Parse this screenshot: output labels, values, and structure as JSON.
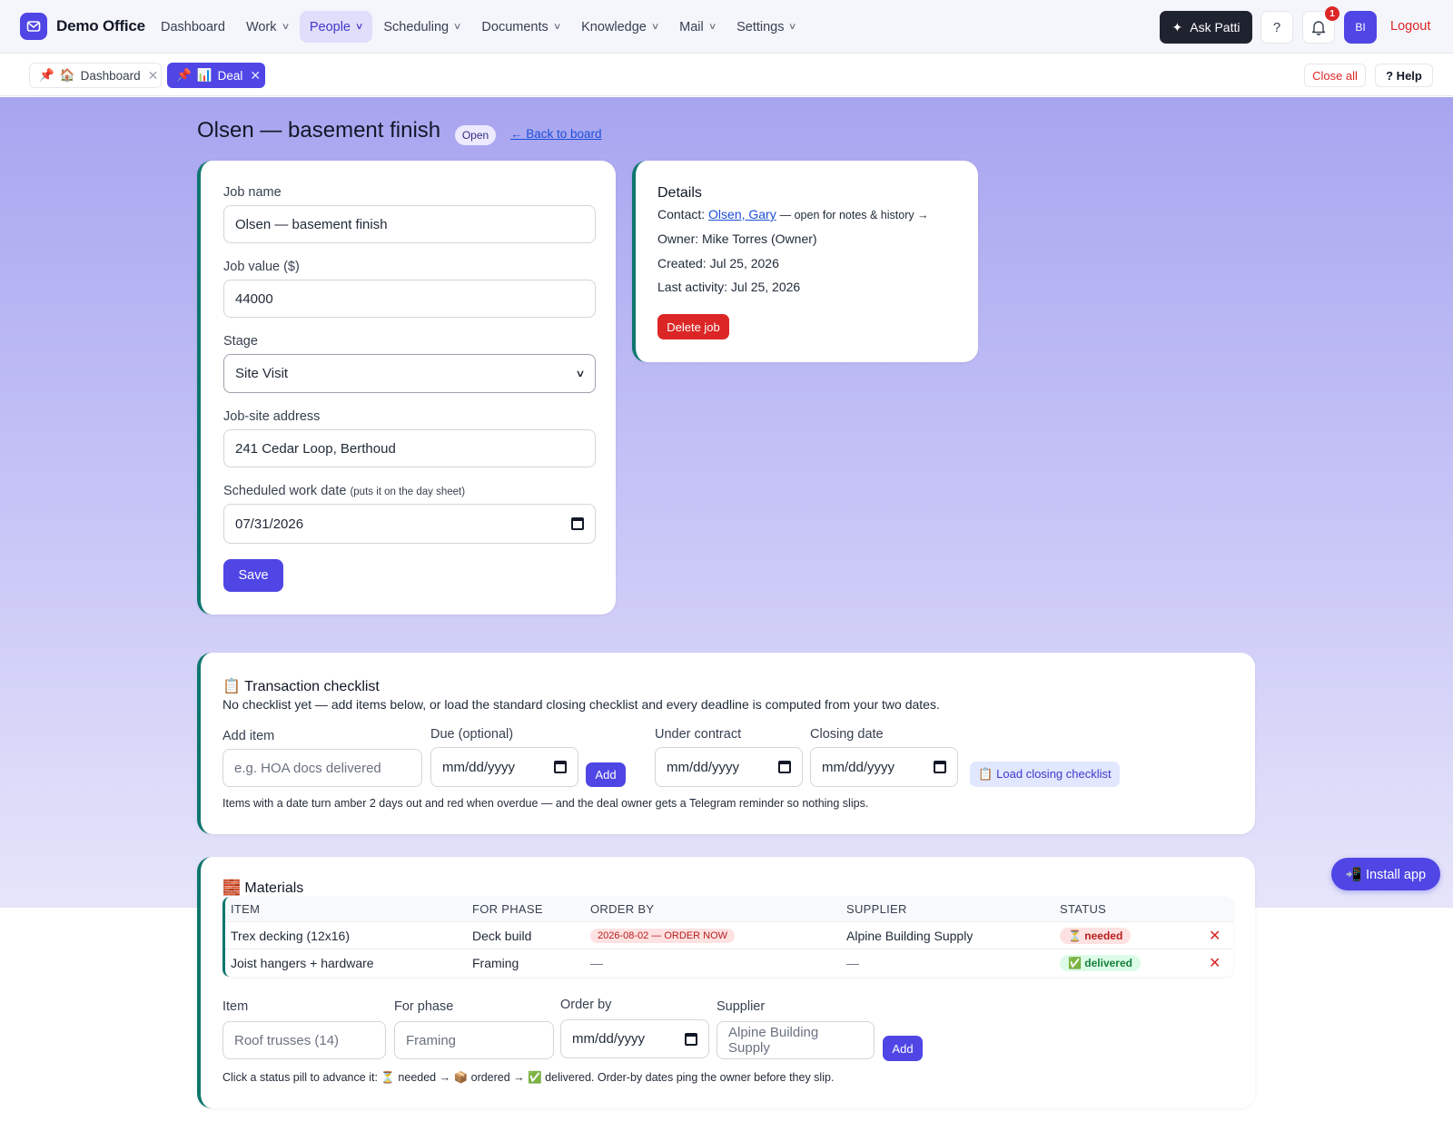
{
  "app": {
    "name": "Demo Office",
    "nav": [
      {
        "label": "Dashboard",
        "has_menu": false
      },
      {
        "label": "Work",
        "has_menu": true
      },
      {
        "label": "People",
        "has_menu": true,
        "active": true
      },
      {
        "label": "Scheduling",
        "has_menu": true
      },
      {
        "label": "Documents",
        "has_menu": true
      },
      {
        "label": "Knowledge",
        "has_menu": true
      },
      {
        "label": "Mail",
        "has_menu": true
      },
      {
        "label": "Settings",
        "has_menu": true
      }
    ],
    "ask_label": "Ask Patti",
    "help_icon_label": "?",
    "notification_count": "1",
    "avatar_initials": "BI",
    "logout_label": "Logout"
  },
  "tabs": [
    {
      "label": "Dashboard",
      "pin": "📌",
      "icon": "🏠"
    },
    {
      "label": "Deal",
      "pin": "📌",
      "icon": "📊",
      "active": true
    }
  ],
  "tabbar": {
    "close_all": "Close all",
    "help": "? Help"
  },
  "deal": {
    "title": "Olsen — basement finish",
    "status": "Open",
    "back_link": "← Back to board"
  },
  "form": {
    "job_name_label": "Job name",
    "job_name_value": "Olsen — basement finish",
    "job_value_label": "Job value ($)",
    "job_value_value": "44000",
    "stage_label": "Stage",
    "stage_value": "Site Visit",
    "address_label": "Job-site address",
    "address_value": "241 Cedar Loop, Berthoud",
    "date_label": "Scheduled work date",
    "date_hint": "(puts it on the day sheet)",
    "date_value": "07/31/2026",
    "save_label": "Save"
  },
  "details": {
    "title": "Details",
    "contact_prefix": "Contact:",
    "contact_name": "Olsen, Gary",
    "contact_note": "— open for notes & history →",
    "owner": "Owner: Mike Torres (Owner)",
    "created": "Created: Jul 25, 2026",
    "last_activity": "Last activity: Jul 25, 2026",
    "delete_label": "Delete job"
  },
  "checklist": {
    "title": "📋 Transaction checklist",
    "empty_text": "No checklist yet — add items below, or load the standard closing checklist and every deadline is computed from your two dates.",
    "add_item_label": "Add item",
    "add_item_placeholder": "e.g. HOA docs delivered",
    "due_label": "Due (optional)",
    "date_placeholder": "mm/dd/yyyy",
    "add_label": "Add",
    "under_contract_label": "Under contract",
    "closing_date_label": "Closing date",
    "load_label": "📋 Load closing checklist",
    "footnote": "Items with a date turn amber 2 days out and red when overdue — and the deal owner gets a Telegram reminder so nothing slips."
  },
  "materials": {
    "title": "🧱 Materials",
    "columns": [
      "ITEM",
      "FOR PHASE",
      "ORDER BY",
      "SUPPLIER",
      "STATUS"
    ],
    "rows": [
      {
        "item": "Trex decking (12x16)",
        "phase": "Deck build",
        "order_by": "2026-08-02 — ORDER NOW",
        "supplier": "Alpine Building Supply",
        "status": "⏳ needed",
        "delete": "✕"
      },
      {
        "item": "Joist hangers + hardware",
        "phase": "Framing",
        "order_by": "—",
        "supplier": "—",
        "status": "✅ delivered",
        "delete": "✕"
      }
    ],
    "form": {
      "item_label": "Item",
      "item_placeholder": "Roof trusses (14)",
      "phase_label": "For phase",
      "phase_placeholder": "Framing",
      "order_by_label": "Order by",
      "order_by_placeholder": "mm/dd/yyyy",
      "supplier_label": "Supplier",
      "supplier_placeholder": "Alpine Building Supply",
      "add_label": "Add"
    },
    "footnote": "Click a status pill to advance it: ⏳ needed → 📦 ordered → ✅ delivered. Order-by dates ping the owner before they slip."
  },
  "install_label": "📲 Install app",
  "colors": {
    "accent": "#4f46e5",
    "danger": "#dc2626",
    "card_border": "#0f766e",
    "success": "#15803d"
  }
}
